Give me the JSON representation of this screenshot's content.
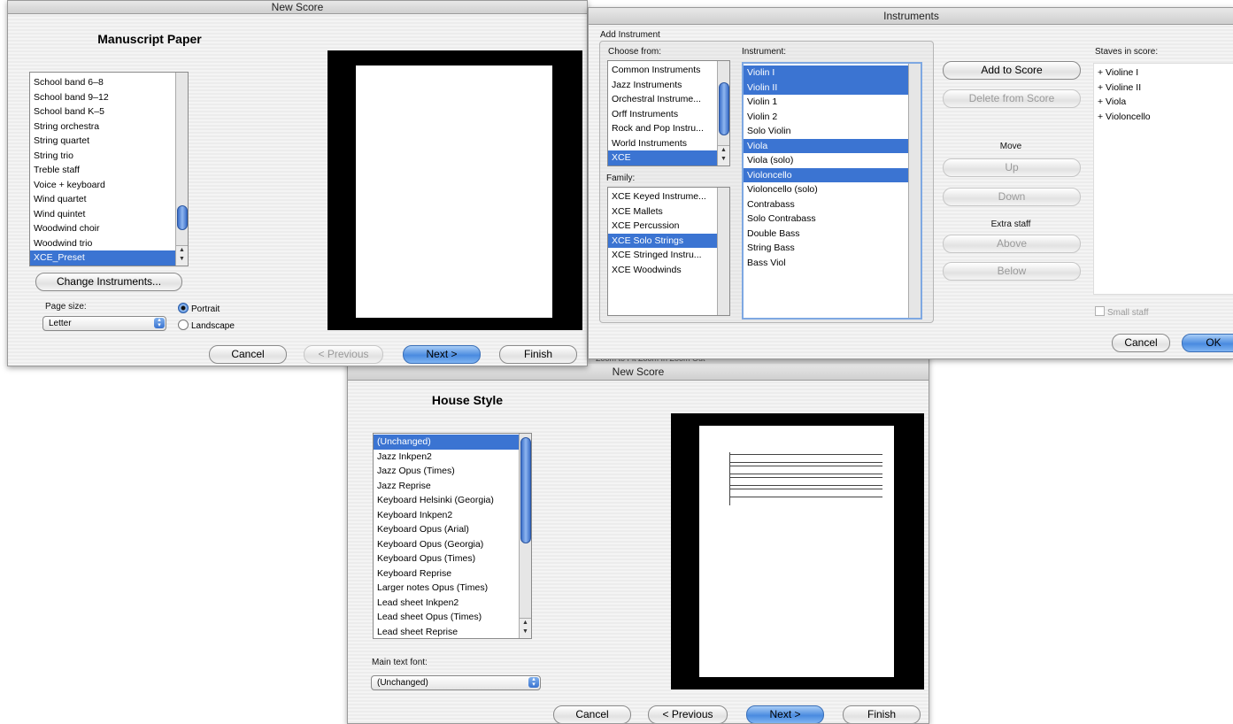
{
  "w1": {
    "title": "New Score",
    "heading": "Manuscript Paper",
    "list_items": [
      "School band 6–8",
      "School band 9–12",
      "School band K–5",
      "String orchestra",
      "String quartet",
      "String trio",
      "Treble staff",
      "Voice + keyboard",
      "Wind quartet",
      "Wind quintet",
      "Woodwind choir",
      "Woodwind trio",
      "XCE_Preset"
    ],
    "selected_item": "XCE_Preset",
    "change_button": "Change Instruments...",
    "page_size_label": "Page size:",
    "page_size_value": "Letter",
    "portrait": "Portrait",
    "landscape": "Landscape",
    "orientation_selected": "Portrait",
    "cancel": "Cancel",
    "previous": "< Previous",
    "next": "Next >",
    "finish": "Finish"
  },
  "w2": {
    "title": "Instruments",
    "add_instrument": "Add Instrument",
    "choose_from_label": "Choose from:",
    "choose_from": [
      "Common Instruments",
      "Jazz Instruments",
      "Orchestral Instrume...",
      "Orff Instruments",
      "Rock and Pop Instru...",
      "World Instruments",
      "XCE"
    ],
    "choose_from_selected": "XCE",
    "family_label": "Family:",
    "family": [
      "XCE Keyed Instrume...",
      "XCE Mallets",
      "XCE Percussion",
      "XCE Solo Strings",
      "XCE Stringed Instru...",
      "XCE Woodwinds"
    ],
    "family_selected": "XCE Solo Strings",
    "instrument_label": "Instrument:",
    "instruments": [
      {
        "name": "Violin I",
        "selected": true
      },
      {
        "name": "Violin II",
        "selected": true
      },
      {
        "name": "Violin 1",
        "selected": false
      },
      {
        "name": "Violin 2",
        "selected": false
      },
      {
        "name": "Solo Violin",
        "selected": false
      },
      {
        "name": "Viola",
        "selected": true
      },
      {
        "name": "Viola (solo)",
        "selected": false
      },
      {
        "name": "Violoncello",
        "selected": true
      },
      {
        "name": "Violoncello (solo)",
        "selected": false
      },
      {
        "name": "Contrabass",
        "selected": false
      },
      {
        "name": "Solo Contrabass",
        "selected": false
      },
      {
        "name": "Double Bass",
        "selected": false
      },
      {
        "name": "String Bass",
        "selected": false
      },
      {
        "name": "Bass Viol",
        "selected": false
      }
    ],
    "add_to_score": "Add to Score",
    "delete_from_score": "Delete from Score",
    "move_label": "Move",
    "up": "Up",
    "down": "Down",
    "extra_staff_label": "Extra staff",
    "above": "Above",
    "below": "Below",
    "staves_label": "Staves in score:",
    "staves": [
      "+ Violine I",
      "+ Violine II",
      "+ Viola",
      "+ Violoncello"
    ],
    "small_staff": "Small staff",
    "cancel": "Cancel",
    "ok": "OK"
  },
  "w3": {
    "title": "New Score",
    "toolbar_hint": "Zoom to Fit   Zoom In   Zoom Out",
    "heading": "House Style",
    "list_items": [
      "(Unchanged)",
      "Jazz Inkpen2",
      "Jazz Opus (Times)",
      "Jazz Reprise",
      "Keyboard Helsinki (Georgia)",
      "Keyboard Inkpen2",
      "Keyboard Opus (Arial)",
      "Keyboard Opus (Georgia)",
      "Keyboard Opus (Times)",
      "Keyboard Reprise",
      "Larger notes Opus (Times)",
      "Lead sheet Inkpen2",
      "Lead sheet Opus (Times)",
      "Lead sheet Reprise"
    ],
    "selected_item": "(Unchanged)",
    "font_label": "Main text font:",
    "font_value": "(Unchanged)",
    "cancel": "Cancel",
    "previous": "< Previous",
    "next": "Next >",
    "finish": "Finish"
  }
}
